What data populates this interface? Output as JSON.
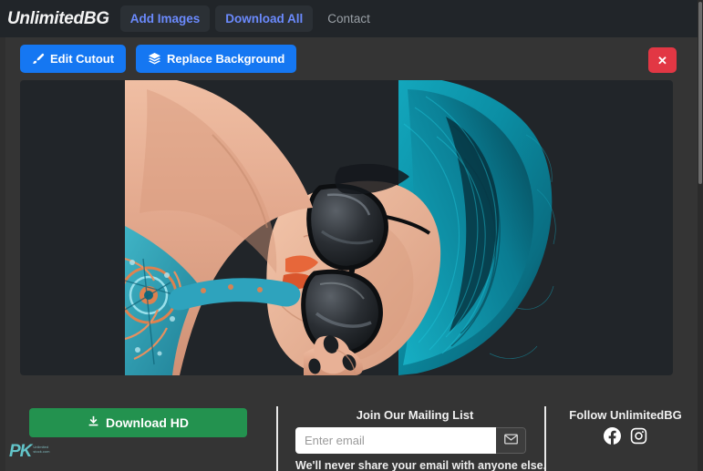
{
  "navbar": {
    "brand": "UnlimitedBG",
    "items": [
      {
        "label": "Add Images",
        "style": "button"
      },
      {
        "label": "Download All",
        "style": "button"
      },
      {
        "label": "Contact",
        "style": "link"
      }
    ]
  },
  "toolbar": {
    "edit_cutout_label": "Edit Cutout",
    "edit_cutout_icon": "brush-icon",
    "replace_background_label": "Replace Background",
    "replace_background_icon": "layers-icon",
    "close_label": "✕",
    "close_icon": "close-icon"
  },
  "canvas": {
    "alt": "Cutout of woman with teal hair wearing sunglasses, rotated 90 degrees",
    "background_color": "#212529"
  },
  "footer": {
    "download": {
      "label": "Download HD",
      "icon": "download-icon",
      "color": "#23924f"
    },
    "watermark": {
      "mark": "PK",
      "line1": "Unlimited",
      "line2": "stock.com"
    },
    "mailing": {
      "title": "Join Our Mailing List",
      "placeholder": "Enter email",
      "value": "",
      "submit_icon": "envelope-icon",
      "note": "We'll never share your email with anyone else."
    },
    "follow": {
      "title": "Follow UnlimitedBG",
      "socials": [
        {
          "name": "facebook-icon",
          "label": "Facebook"
        },
        {
          "name": "instagram-icon",
          "label": "Instagram"
        }
      ]
    }
  },
  "colors": {
    "nav_bg": "#212529",
    "card_bg": "#343434",
    "primary": "#1577f2",
    "danger": "#e23744",
    "success": "#23924f",
    "link": "#6b8afd",
    "hair": "#0b92a8"
  }
}
